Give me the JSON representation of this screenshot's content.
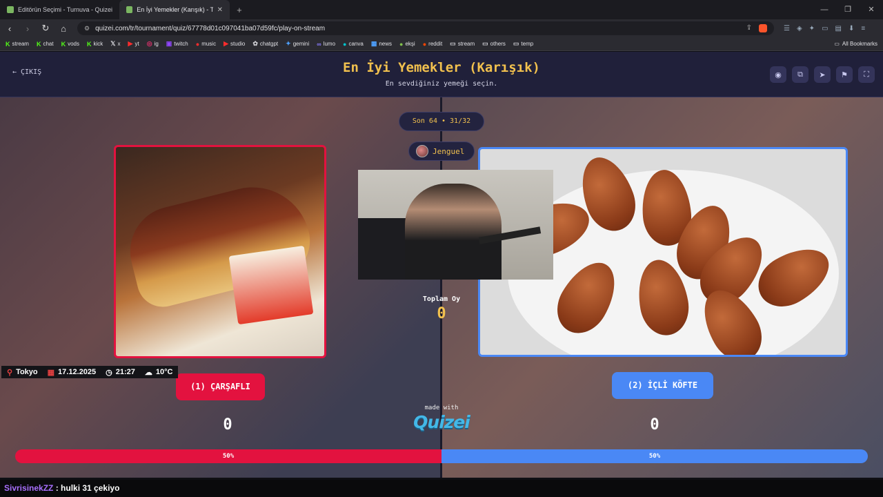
{
  "browser": {
    "tabs": [
      {
        "label": "Editörün Seçimi - Turnuva - Quizei"
      },
      {
        "label": "En İyi Yemekler (Karışık) - Tier Li"
      }
    ],
    "url": "quizei.com/tr/tournament/quiz/67778d01c097041ba07d59fc/play-on-stream",
    "bookmarks": [
      "stream",
      "chat",
      "vods",
      "kick",
      "x",
      "yt",
      "ig",
      "twitch",
      "music",
      "studio",
      "chatgpt",
      "gemini",
      "lumo",
      "canva",
      "news",
      "ekşi",
      "reddit",
      "stream",
      "others",
      "temp"
    ],
    "all_bookmarks": "All Bookmarks"
  },
  "header": {
    "exit_label": "ÇIKIŞ",
    "title": "En İyi Yemekler (Karışık)",
    "subtitle": "En sevdiğiniz yemeği seçin."
  },
  "round": "Son 64 • 31/32",
  "user": "Jenguel",
  "total": {
    "label": "Toplam Oy",
    "value": "0"
  },
  "left": {
    "button": "(1) ÇARŞAFLI",
    "score": "0",
    "percent": 50,
    "percent_label": "50%",
    "color": "#e3123f"
  },
  "right": {
    "button": "(2) İÇLİ KÖFTE",
    "score": "0",
    "percent": 50,
    "percent_label": "50%",
    "color": "#4a88f5"
  },
  "footer": {
    "made_with": "made with",
    "logo": "Quizei"
  },
  "overlay": {
    "city": "Tokyo",
    "date": "17.12.2025",
    "time": "21:27",
    "temp": "10°C"
  },
  "chat": {
    "user": "SivrisinekZZ",
    "message": " : hulki 31 çekiyo"
  }
}
